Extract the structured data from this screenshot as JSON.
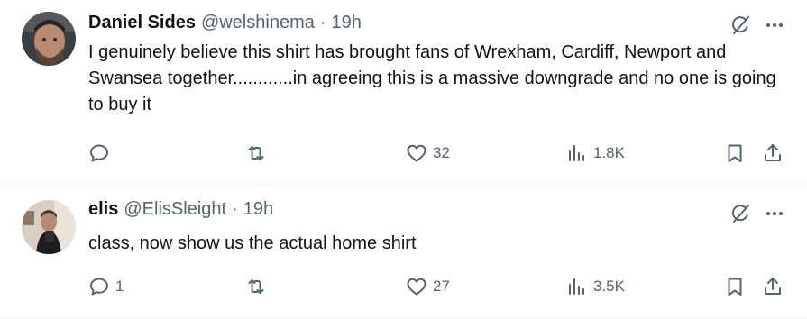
{
  "tweets": [
    {
      "name": "Daniel Sides",
      "handle": "@welshinema",
      "dot": "·",
      "time": "19h",
      "text": "I genuinely believe this shirt has brought fans of Wrexham, Cardiff, Newport and Swansea together............in agreeing this is a massive downgrade and no one is going to buy it",
      "replies": "",
      "retweets": "",
      "likes": "32",
      "views": "1.8K"
    },
    {
      "name": "elis",
      "handle": "@ElisSleight",
      "dot": "·",
      "time": "19h",
      "text": "class, now show us the actual home shirt",
      "replies": "1",
      "retweets": "",
      "likes": "27",
      "views": "3.5K"
    }
  ],
  "icons": {
    "reply": "reply-icon",
    "retweet": "retweet-icon",
    "like": "heart-icon",
    "views": "views-icon",
    "bookmark": "bookmark-icon",
    "share": "share-icon",
    "grok": "grok-icon",
    "more": "more-icon"
  },
  "colors": {
    "text": "#0f1419",
    "secondary": "#536471",
    "divider": "#eff3f4"
  }
}
